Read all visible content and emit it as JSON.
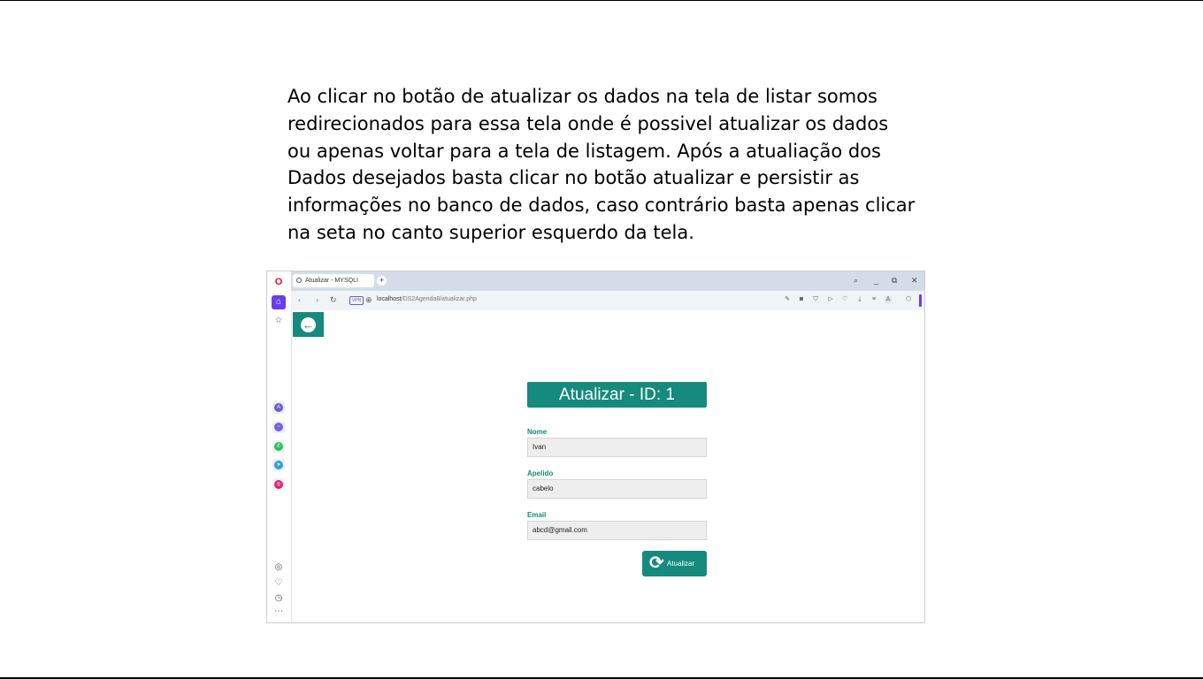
{
  "description": {
    "lines": [
      "Ao clicar no botão de atualizar os dados na tela de listar somos",
      "redirecionados para essa tela onde é possivel atualizar os dados",
      "ou apenas voltar para a tela de listagem.  Após a atualiação dos",
      "Dados desejados basta clicar no botão atualizar e persistir as",
      "informações no banco de dados, caso contrário basta apenas clicar",
      "na seta no canto superior esquerdo da tela."
    ]
  },
  "browser": {
    "tab_title": "Atualizar - MYSQLI",
    "new_tab": "+",
    "vpn_label": "VPN",
    "url_host": "localhost",
    "url_path": "/DS2Agenda8/atualizar.php",
    "window_controls": [
      "search-icon",
      "minimize-icon",
      "restore-icon",
      "close-icon"
    ],
    "toolbar_icons": [
      "edit-icon",
      "camera-icon",
      "shield-icon",
      "play-icon",
      "heart-icon",
      "download-icon",
      "menu-icon",
      "profile-icon",
      "cube-icon"
    ],
    "sidebar_apps": [
      "aria-icon",
      "messenger-icon",
      "whatsapp-icon",
      "telegram-icon",
      "instagram-icon"
    ],
    "sidebar_bottom": [
      "target-icon",
      "heart-icon",
      "history-icon",
      "more-icon"
    ],
    "accent": "#6a3df0"
  },
  "form": {
    "title": "Atualizar - ID: 1",
    "fields": [
      {
        "label": "Nome",
        "value": "Ivan"
      },
      {
        "label": "Apelido",
        "value": "cabelo"
      },
      {
        "label": "Email",
        "value": "abcd@gmail.com"
      }
    ],
    "submit_label": "Atualizar",
    "accent": "#168a7c"
  }
}
